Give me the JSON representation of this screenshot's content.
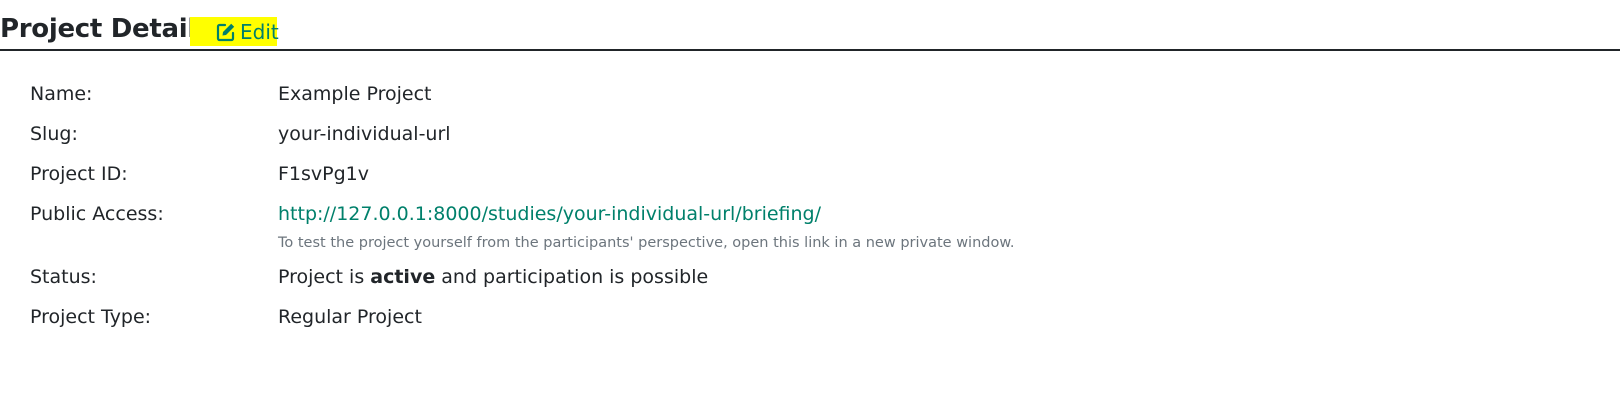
{
  "header": {
    "title": "Project Details",
    "edit_label": "Edit"
  },
  "details": {
    "name": {
      "label": "Name:",
      "value": "Example Project"
    },
    "slug": {
      "label": "Slug:",
      "value": "your-individual-url"
    },
    "project_id": {
      "label": "Project ID:",
      "value": "F1svPg1v"
    },
    "public_access": {
      "label": "Public Access:",
      "url": "http://127.0.0.1:8000/studies/your-individual-url/briefing/",
      "help_text": "To test the project yourself from the participants' perspective, open this link in a new private window."
    },
    "status": {
      "label": "Status:",
      "prefix": "Project is ",
      "emphasis": "active",
      "suffix": " and participation is possible"
    },
    "project_type": {
      "label": "Project Type:",
      "value": "Regular Project"
    }
  },
  "colors": {
    "accent": "#00806b",
    "highlight": "#ffff00",
    "text": "#212529",
    "muted": "#6c757d"
  },
  "icons": {
    "edit": "edit-icon"
  }
}
